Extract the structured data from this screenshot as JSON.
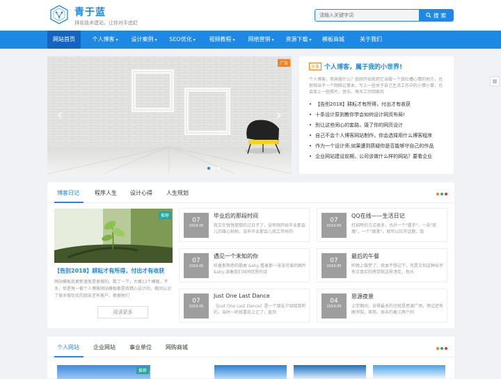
{
  "site": {
    "title": "青于蓝",
    "subtitle": "排名技术建站，让你对手追赶"
  },
  "search": {
    "placeholder": "请输入关键字词",
    "button": "搜 索"
  },
  "nav": [
    {
      "label": "网站首页",
      "active": true,
      "dropdown": false
    },
    {
      "label": "个人博客",
      "active": false,
      "dropdown": true
    },
    {
      "label": "设计案例",
      "active": false,
      "dropdown": true
    },
    {
      "label": "SEO优化",
      "active": false,
      "dropdown": true
    },
    {
      "label": "视频教程",
      "active": false,
      "dropdown": true
    },
    {
      "label": "网络营销",
      "active": false,
      "dropdown": true
    },
    {
      "label": "资源下载",
      "active": false,
      "dropdown": true
    },
    {
      "label": "模板商城",
      "active": false,
      "dropdown": false
    },
    {
      "label": "关于我们",
      "active": false,
      "dropdown": false
    }
  ],
  "slider": {
    "badge": "广告",
    "prev": "‹",
    "next": "›"
  },
  "feature": {
    "tag": "头条",
    "title": "个人博客，属于我的小世界!",
    "text": "个人博客，用来做什么？我刚开始就把它当做一个我吐槽心情的地方，也就相当于一个网络记事本，写上一些关于自己生活工作中的小情小事，也会放上一些照片，音乐。每天工作回家后",
    "items": [
      "【告别2018】耕耘才有所得，付出才有收获",
      "十条设计原则教你学会如何设计网页布局!",
      "别让这些闹心的套路，毁了你的网页设计",
      "自己不会个人博客网站制作，你会选择用什么博客程序",
      "作为一个设计师,如果遭到质疑你是否能够守自己的作品",
      "企业网站建设前期，公司该做什么样的网站？要看企业"
    ]
  },
  "blog": {
    "tabs": [
      "博客日记",
      "程序人生",
      "设计心得",
      "人生规划"
    ],
    "featured": {
      "badge": "推荐",
      "title": "【告别2018】耕耘才有所得，付出才有收获",
      "text": "网站模板我更新速度是很慢的。数了一下，大概12个模板，不多，但是每一套个人博客网站模板都是我精心设计的，期间认识了很多做优化的朋友还有客户，根据他们",
      "more": "阅读更多"
    },
    "cards": [
      {
        "day": "07",
        "ym": "2019-05",
        "title": "毕业后的那段时间",
        "text": "我又在恍恍惚惚的过日子了，没有刚开始毕业那会儿的雄心勃勃。没有毕业那会儿找工作时的"
      },
      {
        "day": "07",
        "ym": "2019-05",
        "title": "QQ在线——生活日记",
        "text": "打招呼的方式很多，也许一个\"握手\"，一朵\"玫瑰\"，一个\"微笑\"，就可以拉开话题，我"
      },
      {
        "day": "07",
        "ym": "2019-05",
        "title": "遇见一个未知的你",
        "text": "听着那熟悉的歌曲 &shy;看着那一张张可爱的图片 &shy;读着我们共同欣赏的诗"
      },
      {
        "day": "07",
        "ym": "2019-05",
        "title": "最后的午餐",
        "text": "昨晚上做梦了，我本不想记下，可是又怕这种似乎有点真实的感觉就这样湮走，枕头"
      },
      {
        "day": "07",
        "ym": "2019-05",
        "title": "Just One Last Dance",
        "text": "《Just One Last Dance》是一个朋友介绍给我听的，当时一听就喜欢上它了，直到"
      },
      {
        "day": "04",
        "ym": "2019-05",
        "title": "思源夜景",
        "text": "上学期间，去得最多的也就是思源广场，旁边还有图书馆，茶苑。周末约着三两个同"
      }
    ]
  },
  "sites": {
    "tabs": [
      "个人网站",
      "企业网站",
      "事业单位",
      "网购商城"
    ],
    "badge": "推荐"
  },
  "colors": {
    "accent": "#1e88e5",
    "orange": "#ff7f17",
    "dots": [
      "#ff7f17",
      "#26a69a",
      "#e53935"
    ]
  }
}
